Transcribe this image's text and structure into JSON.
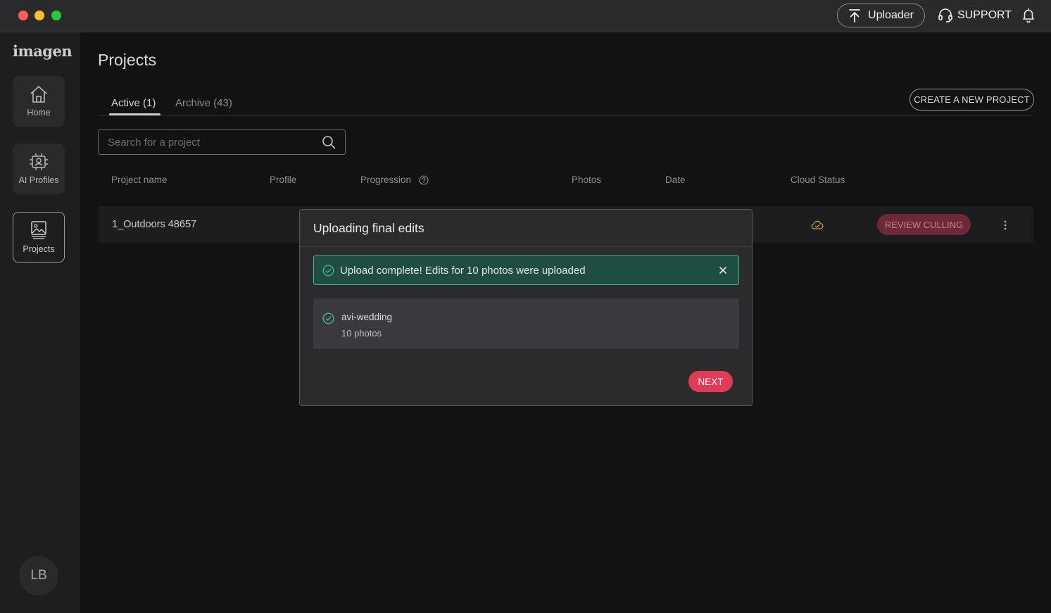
{
  "titlebar": {
    "uploader_label": "Uploader",
    "support_label": "SUPPORT"
  },
  "sidebar": {
    "logo": "imagen",
    "items": [
      {
        "label": "Home",
        "icon": "home-icon"
      },
      {
        "label": "AI Profiles",
        "icon": "ai-profiles-icon"
      },
      {
        "label": "Projects",
        "icon": "projects-icon",
        "active": true
      }
    ],
    "avatar_initials": "LB"
  },
  "main": {
    "title": "Projects",
    "tabs": [
      {
        "label": "Active (1)",
        "active": true
      },
      {
        "label": "Archive (43)",
        "active": false
      }
    ],
    "create_button": "CREATE A NEW PROJECT",
    "search_placeholder": "Search for a project",
    "columns": [
      "Project name",
      "Profile",
      "Progression",
      "Photos",
      "Date",
      "Cloud Status"
    ],
    "rows": [
      {
        "name": "1_Outdoors 48657",
        "action": "REVIEW CULLING"
      }
    ]
  },
  "modal": {
    "title": "Uploading final edits",
    "alert": "Upload complete! Edits for 10 photos were uploaded",
    "upload": {
      "name": "avi-wedding",
      "count": "10 photos"
    },
    "next_label": "NEXT"
  },
  "colors": {
    "accent": "#e03b57",
    "success": "#3fb78f",
    "background": "#121212"
  }
}
